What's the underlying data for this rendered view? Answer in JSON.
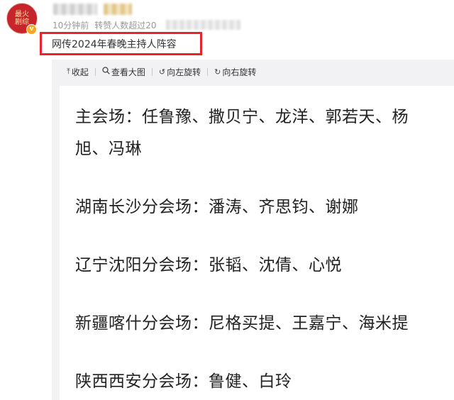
{
  "post": {
    "avatar_text_line1": "最火",
    "avatar_text_line2": "剧综",
    "verified_badge": "v",
    "time": "10分钟前",
    "reposts": "转赞人数超过20",
    "title": "网传2024年春晚主持人阵容"
  },
  "toolbar": {
    "collapse": {
      "icon": "arrow-up-to-line-icon",
      "glyph": "⤒",
      "label": "收起"
    },
    "view_large": {
      "icon": "magnifier-icon",
      "glyph": "○",
      "label": "查看大图"
    },
    "rotate_left": {
      "icon": "rotate-left-icon",
      "glyph": "↺",
      "label": "向左旋转"
    },
    "rotate_right": {
      "icon": "rotate-right-icon",
      "glyph": "↻",
      "label": "向右旋转"
    }
  },
  "image_text": {
    "main_line1": "主会场：任鲁豫、撒贝宁、龙洋、郭若天、杨",
    "main_line2": "旭、冯琳",
    "hunan": "湖南长沙分会场：潘涛、齐思钧、谢娜",
    "liaoning": "辽宁沈阳分会场：张韬、沈倩、心悦",
    "xinjiang": "新疆喀什分会场：尼格买提、王嘉宁、海米提",
    "shaanxi": "陕西西安分会场：鲁健、白玲"
  },
  "colors": {
    "highlight_border": "#e8232b",
    "avatar_bg": "#c8242b",
    "verified_badge": "#f8a71c",
    "panel_bg": "#f2f2f5"
  }
}
